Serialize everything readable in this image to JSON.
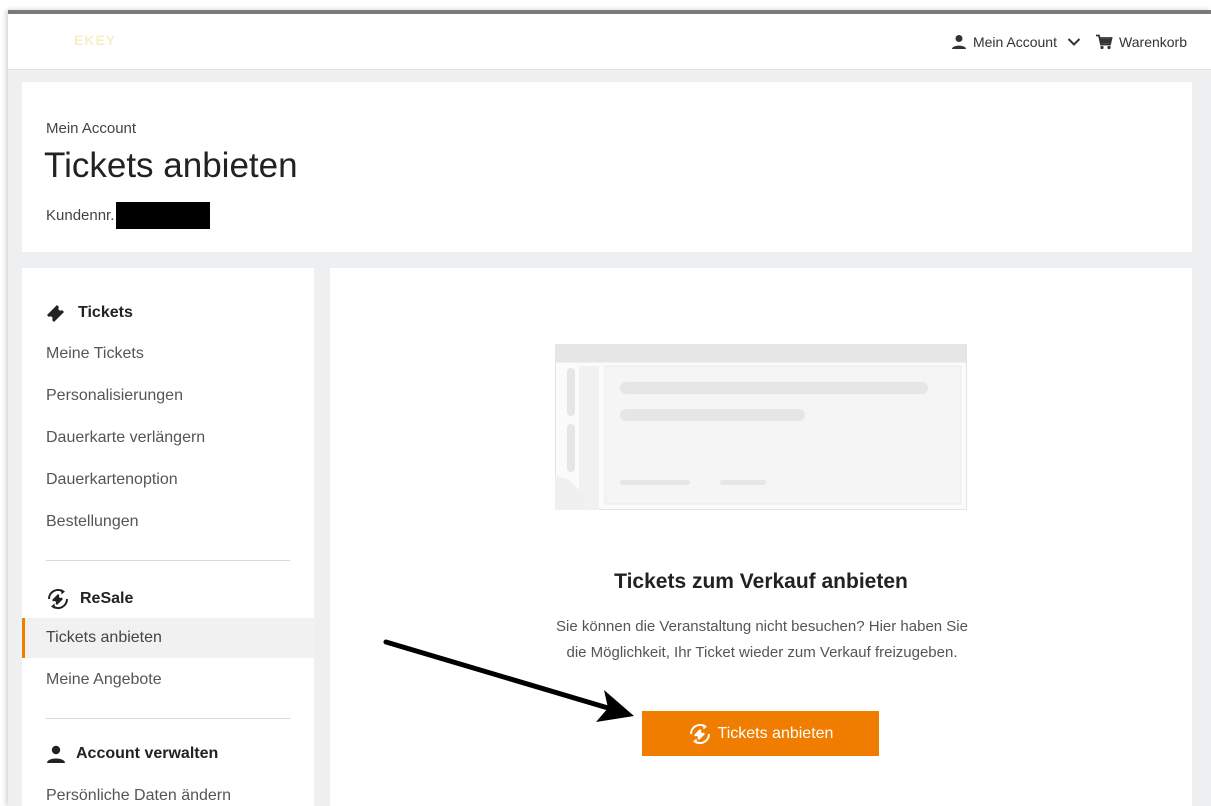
{
  "header": {
    "logo_text": "EKEY",
    "account_label": "Mein Account",
    "cart_label": "Warenkorb"
  },
  "page": {
    "breadcrumb": "Mein Account",
    "title": "Tickets anbieten",
    "customer_no_label": "Kundennr."
  },
  "sidebar": {
    "sections": [
      {
        "title": "Tickets",
        "icon": "ticket-icon",
        "items": [
          "Meine Tickets",
          "Personalisierungen",
          "Dauerkarte verlängern",
          "Dauerkartenoption",
          "Bestellungen"
        ]
      },
      {
        "title": "ReSale",
        "icon": "resale-icon",
        "items": [
          "Tickets anbieten",
          "Meine Angebote"
        ],
        "active": "Tickets anbieten"
      },
      {
        "title": "Account verwalten",
        "icon": "user-icon",
        "items": [
          "Persönliche Daten ändern"
        ]
      }
    ]
  },
  "main": {
    "title": "Tickets zum Verkauf anbieten",
    "description": "Sie können die Veranstaltung nicht besuchen? Hier haben Sie die Möglichkeit, Ihr Ticket wieder zum Verkauf freizugeben.",
    "cta_label": "Tickets anbieten"
  },
  "colors": {
    "accent": "#f07d00",
    "background": "#eeeff1"
  }
}
